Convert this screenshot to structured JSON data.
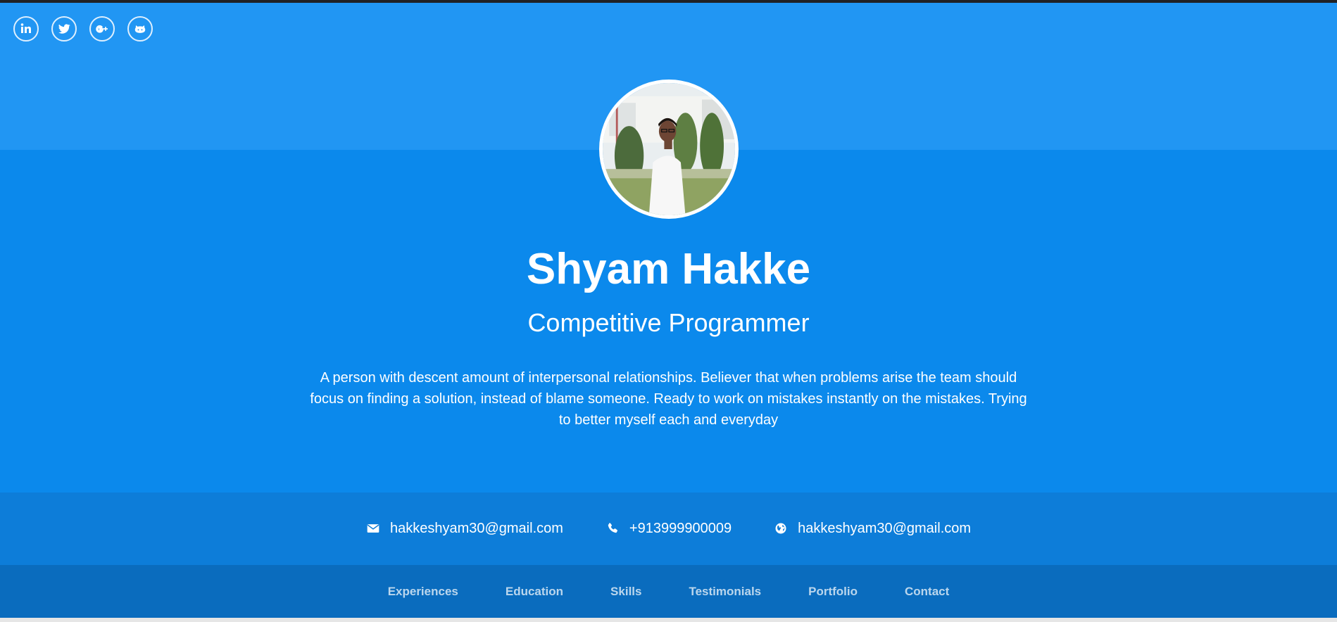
{
  "social": [
    {
      "icon": "linkedin-icon",
      "label": "LinkedIn"
    },
    {
      "icon": "twitter-icon",
      "label": "Twitter"
    },
    {
      "icon": "google-plus-icon",
      "label": "Google Plus"
    },
    {
      "icon": "github-icon",
      "label": "GitHub"
    }
  ],
  "profile": {
    "name": "Shyam Hakke",
    "role": "Competitive Programmer",
    "bio": "A person with descent amount of interpersonal relationships. Believer that when problems arise the team should focus on finding a solution, instead of blame someone. Ready to work on mistakes instantly on the mistakes. Trying to better myself each and everyday"
  },
  "contacts": {
    "email": "hakkeshyam30@gmail.com",
    "phone": "+913999900009",
    "website": "hakkeshyam30@gmail.com"
  },
  "nav": [
    "Experiences",
    "Education",
    "Skills",
    "Testimonials",
    "Portfolio",
    "Contact"
  ],
  "colors": {
    "hero_top": "#2196f3",
    "hero_main": "#0b89ec",
    "contact_bar": "#0d7dd9",
    "nav_bar": "#0a6cbe"
  }
}
